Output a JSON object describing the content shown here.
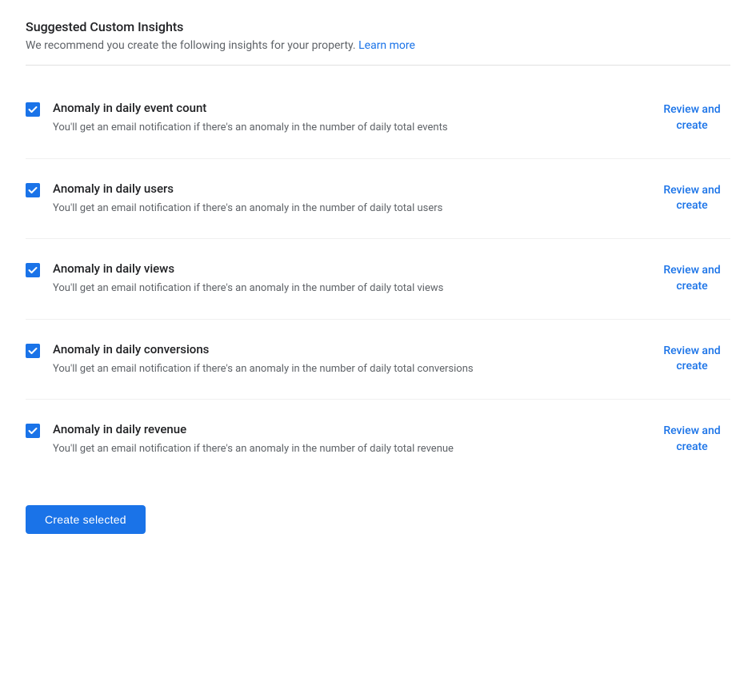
{
  "header": {
    "title": "Suggested Custom Insights",
    "subtitle": "We recommend you create the following insights for your property.",
    "learn_more_label": "Learn more",
    "learn_more_href": "#"
  },
  "insights": [
    {
      "id": "daily-event-count",
      "title": "Anomaly in daily event count",
      "description": "You'll get an email notification if there's an anomaly in the number of daily total events",
      "checked": true,
      "review_label": "Review and create"
    },
    {
      "id": "daily-users",
      "title": "Anomaly in daily users",
      "description": "You'll get an email notification if there's an anomaly in the number of daily total users",
      "checked": true,
      "review_label": "Review and create"
    },
    {
      "id": "daily-views",
      "title": "Anomaly in daily views",
      "description": "You'll get an email notification if there's an anomaly in the number of daily total views",
      "checked": true,
      "review_label": "Review and create"
    },
    {
      "id": "daily-conversions",
      "title": "Anomaly in daily conversions",
      "description": "You'll get an email notification if there's an anomaly in the number of daily total conversions",
      "checked": true,
      "review_label": "Review and create"
    },
    {
      "id": "daily-revenue",
      "title": "Anomaly in daily revenue",
      "description": "You'll get an email notification if there's an anomaly in the number of daily total revenue",
      "checked": true,
      "review_label": "Review and create"
    }
  ],
  "footer": {
    "create_button_label": "Create selected"
  },
  "colors": {
    "accent": "#1a73e8",
    "text_primary": "#202124",
    "text_secondary": "#5f6368"
  }
}
